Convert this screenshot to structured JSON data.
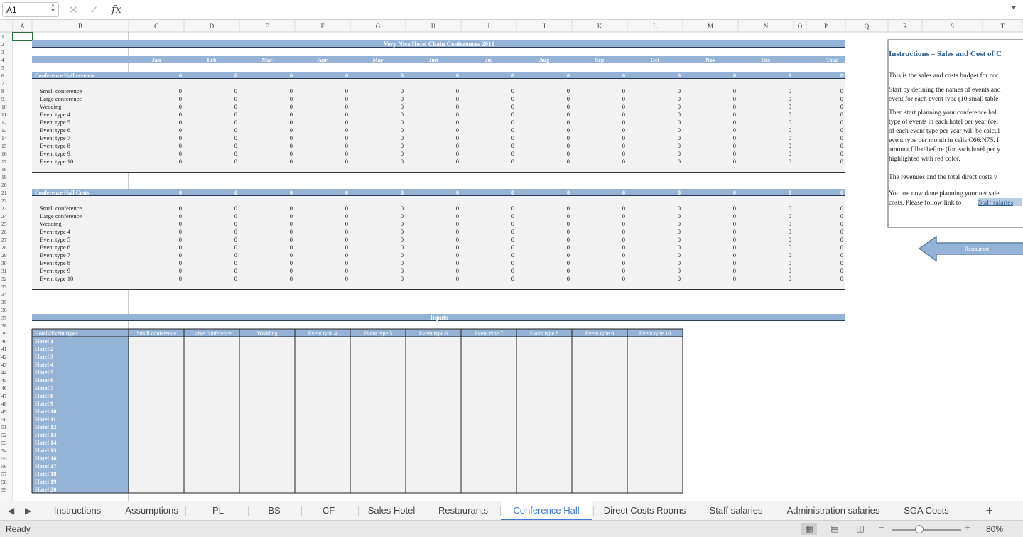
{
  "formula_bar": {
    "cell_ref": "A1",
    "fx_label": "fx",
    "cancel_icon": "close-icon",
    "enter_icon": "check-icon",
    "formula": ""
  },
  "columns": [
    "A",
    "B",
    "C",
    "D",
    "E",
    "F",
    "G",
    "H",
    "I",
    "J",
    "K",
    "L",
    "M",
    "N",
    "O",
    "P",
    "Q",
    "R",
    "S",
    "T"
  ],
  "rows": [
    "1",
    "2",
    "3",
    "4",
    "5",
    "6",
    "7",
    "8",
    "9",
    "10",
    "11",
    "12",
    "13",
    "14",
    "15",
    "16",
    "17",
    "18",
    "19",
    "20",
    "21",
    "22",
    "23",
    "24",
    "25",
    "26",
    "27",
    "28",
    "29",
    "30",
    "31",
    "32",
    "33",
    "34",
    "35",
    "36",
    "37",
    "38",
    "39",
    "40",
    "41",
    "42",
    "43",
    "44",
    "45",
    "46",
    "47",
    "48",
    "49",
    "50",
    "51",
    "52",
    "53",
    "54",
    "55",
    "56",
    "57",
    "58",
    "59"
  ],
  "sheet": {
    "title": "Very Nice Hotel Chain Conferences 2018",
    "months": [
      "Jan",
      "Feb",
      "Mar",
      "Apr",
      "May",
      "Jun",
      "Jul",
      "Aug",
      "Sep",
      "Oct",
      "Nov",
      "Dec",
      "Total"
    ],
    "revenue_header": "Conference Hall revenue",
    "costs_header": "Conference Hall Costs",
    "event_types": [
      "Small conference",
      "Large conference",
      "Wedding",
      "Event type 4",
      "Event type 5",
      "Event type 6",
      "Event type 7",
      "Event type 8",
      "Event type 9",
      "Event type 10"
    ],
    "zero": "0",
    "inputs_title": "Inputs",
    "inputs_corner": "Hotels/Event types",
    "input_columns": [
      "Small conference",
      "Large conference",
      "Wedding",
      "Event type 4",
      "Event type 5",
      "Event type 6",
      "Event type 7",
      "Event type 8",
      "Event type 9",
      "Event type 10"
    ],
    "hotels": [
      "Hotel 1",
      "Hotel 2",
      "Hotel 3",
      "Hotel 4",
      "Hotel 5",
      "Hotel 6",
      "Hotel 7",
      "Hotel 8",
      "Hotel 9",
      "Hotel 10",
      "Hotel 11",
      "Hotel 12",
      "Hotel 13",
      "Hotel 14",
      "Hotel 15",
      "Hotel 16",
      "Hotel 17",
      "Hotel 18",
      "Hotel 19",
      "Hotel 20"
    ]
  },
  "instructions": {
    "title": "Instructions – Sales and Cost of C",
    "lines": [
      "This is the sales and costs budget for cor",
      "Start by defining the names of events and",
      "event for each event type (10 small table",
      "Then start planning your conference hal",
      "type of events in each hotel per year (cel",
      "of each event type per year will be calcul",
      "event type per month in cells C66:N75. I",
      "amount filled before (for each hotel per y",
      "highlighted with red color.",
      "The revenues and the total direct costs v",
      "You are now done planning your net sale",
      "costs. Please follow link to ",
      "Staff salaries"
    ],
    "restaurant_button": "Restaurant"
  },
  "tabs": [
    "Instructions",
    "Assumptions",
    "PL",
    "BS",
    "CF",
    "Sales Hotel",
    "Restaurants",
    "Conference Hall",
    "Direct Costs Rooms",
    "Staff salaries",
    "Administration salaries",
    "SGA Costs"
  ],
  "active_tab": "Conference Hall",
  "status": {
    "text": "Ready",
    "zoom": "80%",
    "zoom_fraction": 0.4
  },
  "colors": {
    "header_band": "#95b3d7",
    "band_text": "#ffffff",
    "body_fill": "#f2f2f2",
    "active_tab": "#3b7bd0",
    "arrow_fill": "#95b3d7"
  }
}
